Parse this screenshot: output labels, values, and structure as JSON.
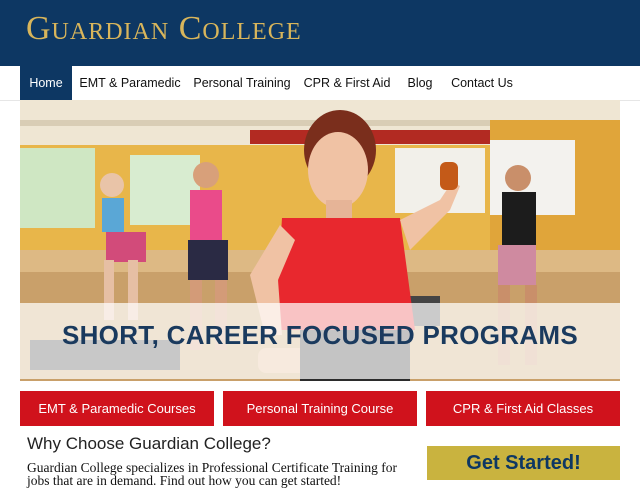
{
  "site": {
    "title": "Guardian College"
  },
  "nav": {
    "items": [
      {
        "label": "Home",
        "active": true
      },
      {
        "label": "EMT & Paramedic"
      },
      {
        "label": "Personal Training"
      },
      {
        "label": "CPR & First Aid"
      },
      {
        "label": "Blog"
      },
      {
        "label": "Contact Us"
      }
    ]
  },
  "hero": {
    "caption": "SHORT, CAREER FOCUSED PROGRAMS"
  },
  "programs": [
    {
      "label": "EMT & Paramedic Courses"
    },
    {
      "label": "Personal Training Course"
    },
    {
      "label": "CPR & First Aid Classes"
    }
  ],
  "content": {
    "heading": "Why Choose Guardian College?",
    "body": "Guardian College specializes in Professional Certificate Training for jobs that are in demand. Find out how you can get started!"
  },
  "sidebar": {
    "cta_label": "Get Started!"
  },
  "colors": {
    "brand_navy": "#0d3763",
    "brand_gold": "#d8b55b",
    "cta_red": "#d0121c",
    "button_gold": "#c9b33f"
  }
}
